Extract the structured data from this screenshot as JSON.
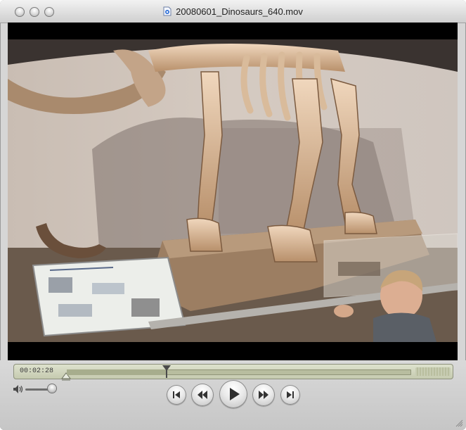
{
  "window": {
    "title": "20080601_Dinosaurs_640.mov",
    "buttons": [
      "close-button",
      "minimize-button",
      "zoom-button"
    ]
  },
  "player": {
    "current_time": "00:02:28",
    "progress": 0.29,
    "volume_level": 0.9
  },
  "icons": {
    "title_doc": "quicktime-document-icon",
    "volume": "speaker-icon",
    "go_to_start": "skip-back-icon",
    "rewind": "rewind-icon",
    "play": "play-icon",
    "fast_forward": "fast-forward-icon",
    "go_to_end": "skip-forward-icon",
    "resize": "resize-grip-icon"
  },
  "colors": {
    "timeline_bg": "#c4c9ae",
    "window_bg": "#d6d6d6",
    "video_bg": "#000000"
  }
}
